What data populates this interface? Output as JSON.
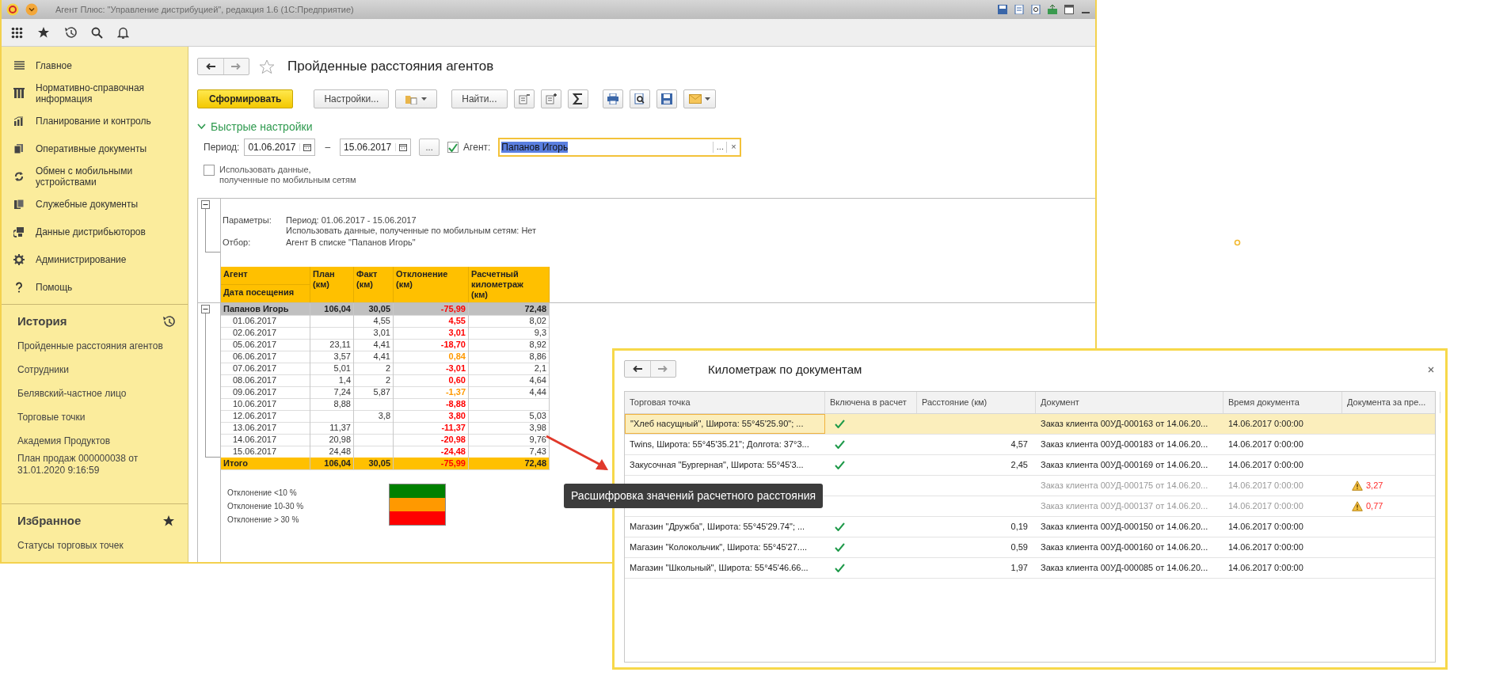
{
  "window": {
    "title": "Агент Плюс: \"Управление дистрибуцией\", редакция 1.6  (1С:Предприятие)"
  },
  "sidebar": {
    "items": [
      {
        "label": "Главное"
      },
      {
        "label": "Нормативно-справочная информация"
      },
      {
        "label": "Планирование и контроль"
      },
      {
        "label": "Оперативные документы"
      },
      {
        "label": "Обмен с мобильными устройствами"
      },
      {
        "label": "Служебные документы"
      },
      {
        "label": "Данные дистрибьюторов"
      },
      {
        "label": "Администрирование"
      },
      {
        "label": "Помощь"
      }
    ]
  },
  "history": {
    "title": "История",
    "items": [
      "Пройденные расстояния агентов",
      "Сотрудники",
      "Белявский-частное лицо",
      "Торговые точки",
      "Академия Продуктов",
      "План продаж 000000038 от 31.01.2020 9:16:59"
    ]
  },
  "favorites": {
    "title": "Избранное",
    "items": [
      "Статусы торговых точек"
    ]
  },
  "report": {
    "title": "Пройденные расстояния агентов",
    "favorite": false,
    "generate_button": "Сформировать",
    "settings_button": "Настройки...",
    "find_button": "Найти...",
    "quick_settings": {
      "title": "Быстрые настройки",
      "expanded": true,
      "period_label": "Период:",
      "date_from": "01.06.2017",
      "range_separator": "–",
      "date_to": "15.06.2017",
      "period_button": "...",
      "agent_checked": true,
      "agent_label": "Агент:",
      "agent_value": "Папанов Игорь",
      "agent_select": "...",
      "agent_clear": "×",
      "mobile_checked": false,
      "mobile_label": "Использовать данные,\nполученные по мобильным сетям"
    },
    "params": [
      {
        "label": "Параметры:",
        "lines": [
          "Период: 01.06.2017 - 15.06.2017",
          "Использовать данные, полученные по мобильным сетям: Нет"
        ]
      },
      {
        "label": "Отбор:",
        "lines": [
          "Агент В списке \"Папанов Игорь\""
        ]
      }
    ],
    "params_expanded": true,
    "columns": [
      "Агент",
      "Дата посещения",
      "План (км)",
      "Факт (км)",
      "Отклонение (км)",
      "Расчетный километраж (км)"
    ],
    "group": {
      "agent": "Папанов Игорь",
      "plan": "106,04",
      "fact": "30,05",
      "deviation": "-75,99",
      "color": "#ff0000",
      "mileage": "72,48",
      "expanded": true
    },
    "rows": [
      {
        "date": "01.06.2017",
        "plan": "",
        "fact": "4,55",
        "deviation": "4,55",
        "color": "#ff0000",
        "mileage": "8,02"
      },
      {
        "date": "02.06.2017",
        "plan": "",
        "fact": "3,01",
        "deviation": "3,01",
        "color": "#ff0000",
        "mileage": "9,3"
      },
      {
        "date": "05.06.2017",
        "plan": "23,11",
        "fact": "4,41",
        "deviation": "-18,70",
        "color": "#ff0000",
        "mileage": "8,92"
      },
      {
        "date": "06.06.2017",
        "plan": "3,57",
        "fact": "4,41",
        "deviation": "0,84",
        "color": "#ff9900",
        "mileage": "8,86"
      },
      {
        "date": "07.06.2017",
        "plan": "5,01",
        "fact": "2",
        "deviation": "-3,01",
        "color": "#ff0000",
        "mileage": "2,1"
      },
      {
        "date": "08.06.2017",
        "plan": "1,4",
        "fact": "2",
        "deviation": "0,60",
        "color": "#ff0000",
        "mileage": "4,64"
      },
      {
        "date": "09.06.2017",
        "plan": "7,24",
        "fact": "5,87",
        "deviation": "-1,37",
        "color": "#ff9900",
        "mileage": "4,44"
      },
      {
        "date": "10.06.2017",
        "plan": "8,88",
        "fact": "",
        "deviation": "-8,88",
        "color": "#ff0000",
        "mileage": ""
      },
      {
        "date": "12.06.2017",
        "plan": "",
        "fact": "3,8",
        "deviation": "3,80",
        "color": "#ff0000",
        "mileage": "5,03"
      },
      {
        "date": "13.06.2017",
        "plan": "11,37",
        "fact": "",
        "deviation": "-11,37",
        "color": "#ff0000",
        "mileage": "3,98"
      },
      {
        "date": "14.06.2017",
        "plan": "20,98",
        "fact": "",
        "deviation": "-20,98",
        "color": "#ff0000",
        "mileage": "9,76"
      },
      {
        "date": "15.06.2017",
        "plan": "24,48",
        "fact": "",
        "deviation": "-24,48",
        "color": "#ff0000",
        "mileage": "7,43"
      }
    ],
    "total": {
      "label": "Итого",
      "plan": "106,04",
      "fact": "30,05",
      "deviation": "-75,99",
      "color": "#ff0000",
      "mileage": "72,48"
    },
    "legend": [
      {
        "label": "Отклонение <10 %",
        "color": "#008000"
      },
      {
        "label": "Отклонение 10-30 %",
        "color": "#ff9900"
      },
      {
        "label": "Отклонение > 30 %",
        "color": "#ff0000"
      }
    ]
  },
  "tooltip": "Расшифровка значений расчетного расстояния",
  "dialog": {
    "title": "Километраж по документам",
    "columns": [
      "Торговая точка",
      "Включена в расчет",
      "Расстояние (км)",
      "Документ",
      "Время документа",
      "Документа за пре..."
    ],
    "rows": [
      {
        "point": "\"Хлеб насущный\", Широта: 55°45'25.90\"; ...",
        "included": true,
        "distance": "",
        "document": "Заказ клиента 00УД-000163 от 14.06.20...",
        "time": "14.06.2017 0:00:00",
        "warning": false,
        "selected": true
      },
      {
        "point": "Twins, Широта: 55°45'35.21\"; Долгота: 37°3...",
        "included": true,
        "distance": "4,57",
        "document": "Заказ клиента 00УД-000183 от 14.06.20...",
        "time": "14.06.2017 0:00:00",
        "warning": false,
        "selected": false
      },
      {
        "point": "Закусочная \"Бургерная\", Широта: 55°45'3...",
        "included": true,
        "distance": "2,45",
        "document": "Заказ клиента 00УД-000169 от 14.06.20...",
        "time": "14.06.2017 0:00:00",
        "warning": false,
        "selected": false
      },
      {
        "included": false,
        "distance": "",
        "document": "Заказ клиента 00УД-000175 от 14.06.20...",
        "time": "14.06.2017 0:00:00",
        "warning": true,
        "previous": "3,27",
        "selected": false
      },
      {
        "included": false,
        "distance": "",
        "document": "Заказ клиента 00УД-000137 от 14.06.20...",
        "time": "14.06.2017 0:00:00",
        "warning": true,
        "previous": "0,77",
        "selected": false
      },
      {
        "point": "Магазин \"Дружба\", Широта: 55°45'29.74\"; ...",
        "included": true,
        "distance": "0,19",
        "document": "Заказ клиента 00УД-000150 от 14.06.20...",
        "time": "14.06.2017 0:00:00",
        "warning": false,
        "selected": false
      },
      {
        "point": "Магазин \"Колокольчик\", Широта: 55°45'27....",
        "included": true,
        "distance": "0,59",
        "document": "Заказ клиента 00УД-000160 от 14.06.20...",
        "time": "14.06.2017 0:00:00",
        "warning": false,
        "selected": false
      },
      {
        "point": "Магазин \"Школьный\", Широта: 55°45'46.66...",
        "included": true,
        "distance": "1,97",
        "document": "Заказ клиента 00УД-000085 от 14.06.20...",
        "time": "14.06.2017 0:00:00",
        "warning": false,
        "selected": false
      }
    ]
  }
}
